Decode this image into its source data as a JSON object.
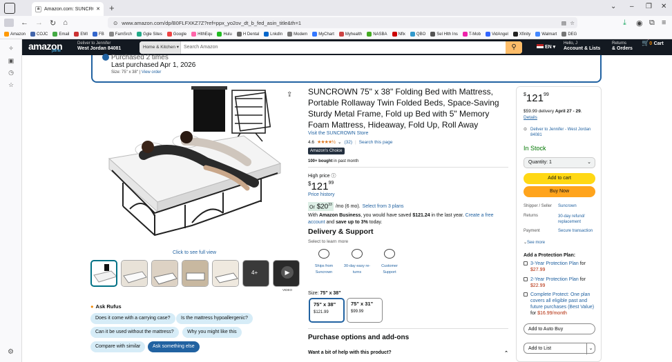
{
  "browser": {
    "tab_title": "Amazon.com: SUNCROWN 75\" x",
    "new_tab": "+",
    "url": "www.amazon.com/dp/B0FLFXKZ7Z?ref=ppx_yo2ov_dt_b_fed_asin_title&th=1",
    "bookmarks": [
      "Amazon",
      "COJC",
      "Email",
      "EMI",
      "FB",
      "FamSrch",
      "Ggle Sites",
      "Google",
      "HlthEqu",
      "Hulu",
      "H Dental",
      "LnkdIn",
      "Modem",
      "MyChart",
      "Myhealth",
      "NASBA",
      "Nflx",
      "QBO",
      "Sel Hlth Ins",
      "T-Mob",
      "VidAngel",
      "Xfinity",
      "Walmart",
      "DEG"
    ]
  },
  "header": {
    "logo": "amazon",
    "logo_sub": "prime",
    "deliver_line1": "Deliver to Jennifer",
    "deliver_line2": "West Jordan 84081",
    "category": "Home & Kitchen",
    "search_placeholder": "Search Amazon",
    "lang": "EN",
    "account_line1": "Hello, J",
    "account_line2": "Account & Lists",
    "returns_line1": "Returns",
    "returns_line2": "& Orders",
    "cart_count": "0",
    "cart_label": "Cart"
  },
  "purchased": {
    "title": "Purchased 2 times",
    "last": "Last purchased Apr 1, 2026",
    "size": "Size: 75\" x 38\" |",
    "view_order": "View order"
  },
  "gallery": {
    "full_view": "Click to see full view",
    "video_label": "VIDEO",
    "more_count": "4+"
  },
  "rufus": {
    "label": "Ask Rufus",
    "chips": [
      "Does it come with a carrying case?",
      "Is the mattress hypoallergenic?",
      "Can it be used without the mattress?",
      "Why you might like this",
      "Compare with similar",
      "Ask something else"
    ]
  },
  "product": {
    "title": "SUNCROWN 75\" x 38\" Folding Bed with Mattress, Portable Rollaway Twin Folded Beds, Space-Saving Sturdy Metal Frame, Fold up Bed with 5\" Memory Foam Mattress, Hideaway, Fold Up, Roll Away",
    "store": "Visit the SUNCROWN Store",
    "rating": "4.6",
    "stars": "★★★★½",
    "rating_count": "(32)",
    "search_page": "Search this page",
    "choice": "Amazon's Choice",
    "bought_bold": "100+ bought",
    "bought_rest": " in past month",
    "high_price": "High price",
    "price_whole": "121",
    "price_frac": "99",
    "currency": "$",
    "price_history": "Price history",
    "plan_or": "Or",
    "plan_amt": "$20",
    "plan_amt_frac": "33",
    "plan_rest": "/mo (6 mo).",
    "plan_link": "Select from 3 plans",
    "business_pre": "With ",
    "business_bold": "Amazon Business",
    "business_mid": ", you would have saved ",
    "business_saved": "$121.24",
    "business_post": " in the last year. ",
    "business_link": "Create a free account",
    "business_end_pre": " and ",
    "business_end": "save up to 3%",
    "business_tail": " today.",
    "delivery_heading": "Delivery & Support",
    "delivery_sub": "Select to learn more",
    "delivery_items": [
      "Ships from Suncrown",
      "30-day easy re-turns",
      "Customer Support"
    ],
    "size_label": "Size: ",
    "size_value": "75\" x 38\"",
    "sizes": [
      {
        "name": "75\" x 38\"",
        "price": "$121.99"
      },
      {
        "name": "75\" x 31\"",
        "price": "$99.99"
      }
    ],
    "purchase_options": "Purchase options and add-ons",
    "help": "Want a bit of help with this product?"
  },
  "buybox": {
    "price_whole": "121",
    "price_frac": "99",
    "delivery_pre": "$59.99 delivery ",
    "delivery_date": "April 27 - 29",
    "delivery_post": ".",
    "details": "Details",
    "location": "Deliver to Jennifer - West Jordan 84081",
    "in_stock": "In Stock",
    "quantity": "Quantity: 1",
    "add_to_cart": "Add to cart",
    "buy_now": "Buy Now",
    "rows": [
      {
        "k": "Shipper / Seller",
        "v": "Suncrown"
      },
      {
        "k": "Returns",
        "v": "30-day refund/ replacement"
      },
      {
        "k": "Payment",
        "v": "Secure transaction"
      }
    ],
    "see_more": "See more",
    "protection_heading": "Add a Protection Plan:",
    "plans": [
      {
        "label": "3-Year Protection Plan",
        "for": " for ",
        "price": "$27.99"
      },
      {
        "label": "2-Year Protection Plan",
        "for": " for ",
        "price": "$22.99"
      },
      {
        "label": "Complete Protect: One plan covers all eligible past and future purchases (Best Value)",
        "for": " for ",
        "price": "$16.99/month"
      }
    ],
    "auto_buy": "Add to Auto Buy",
    "add_to_list": "Add to List"
  }
}
